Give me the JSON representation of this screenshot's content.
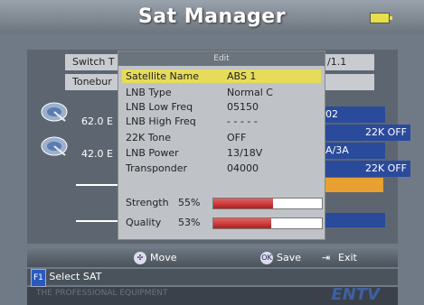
{
  "header": {
    "title": "Sat Manager",
    "battery_icon": "battery-icon"
  },
  "background_rows": {
    "switch_label": "Switch T",
    "switch_value": "/1.1",
    "tone_label": "Tonebur",
    "satellites": [
      {
        "pos": "62.0 E",
        "right_top": "02",
        "right_bottom": "22K OFF"
      },
      {
        "pos": "42.0 E",
        "right_top": "A/3A",
        "right_bottom": "22K OFF"
      }
    ]
  },
  "dialog": {
    "title": "Edit",
    "fields": [
      {
        "label": "Satellite Name",
        "value": "ABS 1"
      },
      {
        "label": "LNB Type",
        "value": "Normal C"
      },
      {
        "label": "LNB Low Freq",
        "value": "05150"
      },
      {
        "label": "LNB High Freq",
        "value": "- - - - -"
      },
      {
        "label": "22K Tone",
        "value": "OFF"
      },
      {
        "label": "LNB Power",
        "value": "13/18V"
      },
      {
        "label": "Transponder",
        "value": "04000"
      }
    ],
    "strength": {
      "label": "Strength",
      "percent_text": "55%",
      "value": 55
    },
    "quality": {
      "label": "Quality",
      "percent_text": "53%",
      "value": 53
    }
  },
  "hints": {
    "move": "Move",
    "move_icon": "dpad-icon",
    "ok_badge": "OK",
    "save": "Save",
    "save_icon": "ok-button-icon",
    "exit": "Exit",
    "exit_icon": "exit-icon",
    "f1_badge": "F1",
    "select_sat": "Select SAT"
  },
  "watermark": {
    "left": "THE PROFESSIONAL EQUIPMENT",
    "right": "ENTV"
  }
}
